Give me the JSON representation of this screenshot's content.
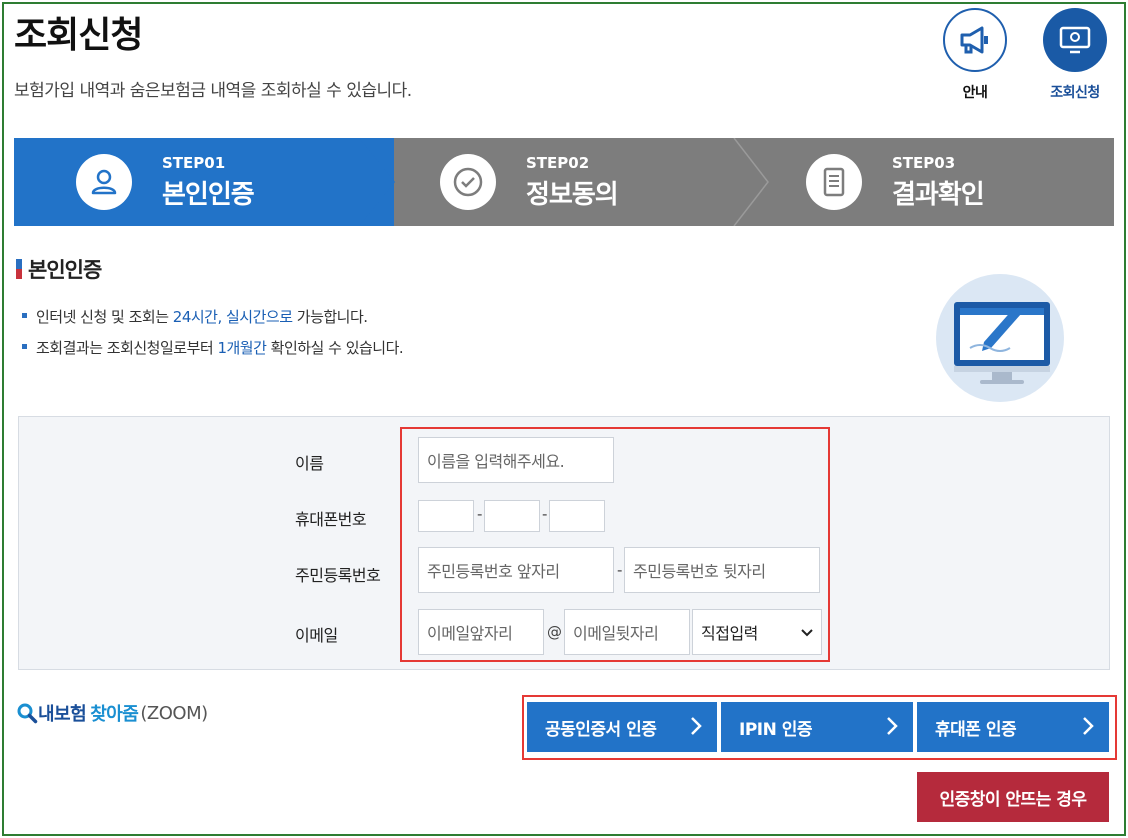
{
  "header": {
    "title": "조회신청",
    "subtitle": "보험가입 내역과 숨은보험금 내역을 조회하실 수 있습니다."
  },
  "quick_links": {
    "guide_label": "안내",
    "apply_label": "조회신청"
  },
  "steps": [
    {
      "num": "STEP01",
      "name": "본인인증",
      "icon": "person-icon",
      "active": true
    },
    {
      "num": "STEP02",
      "name": "정보동의",
      "icon": "check-circle-icon",
      "active": false
    },
    {
      "num": "STEP03",
      "name": "결과확인",
      "icon": "document-icon",
      "active": false
    }
  ],
  "section": {
    "title": "본인인증",
    "notes": [
      {
        "pre": "인터넷 신청 및 조회는 ",
        "hl": "24시간, 실시간으로",
        "post": " 가능합니다."
      },
      {
        "pre": "조회결과는 조회신청일로부터 ",
        "hl": "1개월간",
        "post": " 확인하실 수 있습니다."
      }
    ],
    "illustration": "monitor-pen-illustration"
  },
  "form": {
    "name_label": "이름",
    "name_placeholder": "이름을 입력해주세요.",
    "phone_label": "휴대폰번호",
    "phone_sep": "-",
    "rrn_label": "주민등록번호",
    "rrn_front_placeholder": "주민등록번호 앞자리",
    "rrn_back_placeholder": "주민등록번호 뒷자리",
    "rrn_sep": "-",
    "email_label": "이메일",
    "email_front_placeholder": "이메일앞자리",
    "email_at": "@",
    "email_back_placeholder": "이메일뒷자리",
    "email_domain_selected": "직접입력"
  },
  "zoom": {
    "part1": "내보험",
    "part2": "찾아줌",
    "part3": "(ZOOM)"
  },
  "auth_buttons": {
    "cert": "공동인증서 인증",
    "ipin": "IPIN 인증",
    "phone": "휴대폰 인증"
  },
  "fail_button": "인증창이 안뜨는 경우",
  "colors": {
    "primary": "#2273c8",
    "step_inactive": "#7d7d7d",
    "accent_red": "#b52a3c",
    "highlight_border": "#e53935",
    "frame": "#2e7d32"
  }
}
